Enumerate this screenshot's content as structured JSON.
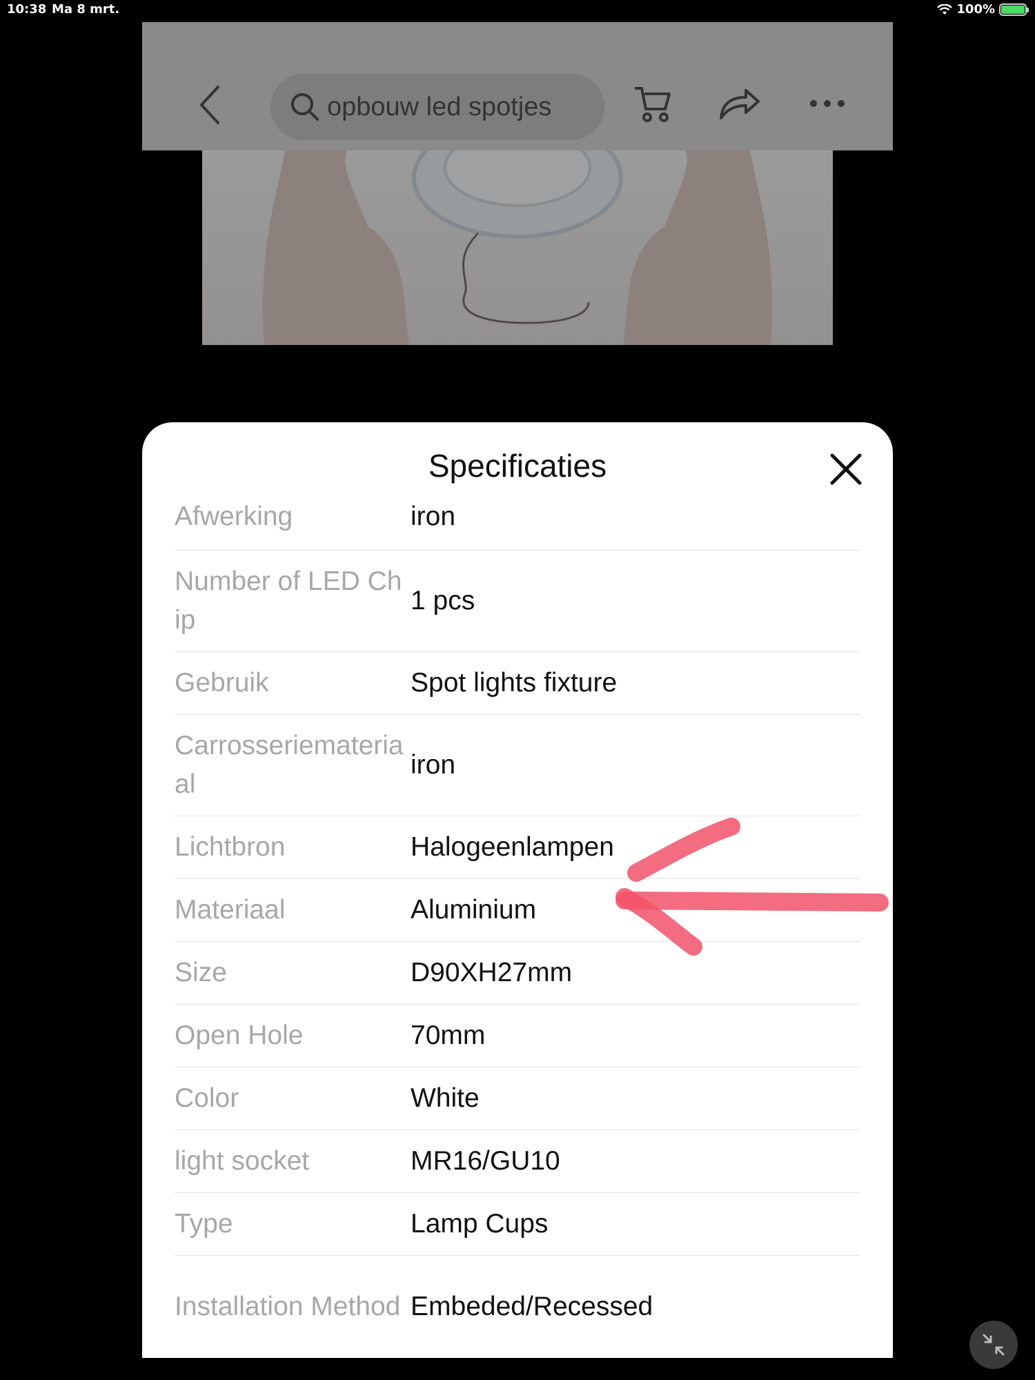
{
  "status_bar": {
    "time": "10:38",
    "date": "Ma 8 mrt.",
    "battery": "100%"
  },
  "header": {
    "search_query": "opbouw led spotjes",
    "icons": [
      "back-icon",
      "search-icon",
      "cart-icon",
      "share-icon",
      "more-icon"
    ]
  },
  "sheet": {
    "title": "Specificaties",
    "specs": [
      {
        "key": "Afwerking",
        "value": "iron"
      },
      {
        "key": "Number of LED Chip",
        "value": "1 pcs"
      },
      {
        "key": "Gebruik",
        "value": "Spot lights fixture"
      },
      {
        "key": "Carrosseriemateriaal",
        "value": "iron"
      },
      {
        "key": "Lichtbron",
        "value": "Halogeenlampen"
      },
      {
        "key": "Materiaal",
        "value": "Aluminium"
      },
      {
        "key": "Size",
        "value": "D90XH27mm"
      },
      {
        "key": "Open Hole",
        "value": "70mm"
      },
      {
        "key": "Color",
        "value": "White"
      },
      {
        "key": "light socket",
        "value": "MR16/GU10"
      },
      {
        "key": "Type",
        "value": "Lamp Cups"
      },
      {
        "key": "Installation Method",
        "value": "Embeded/Recessed"
      }
    ]
  },
  "colors": {
    "annotation": "#f2526a",
    "battery": "#4cd964"
  }
}
